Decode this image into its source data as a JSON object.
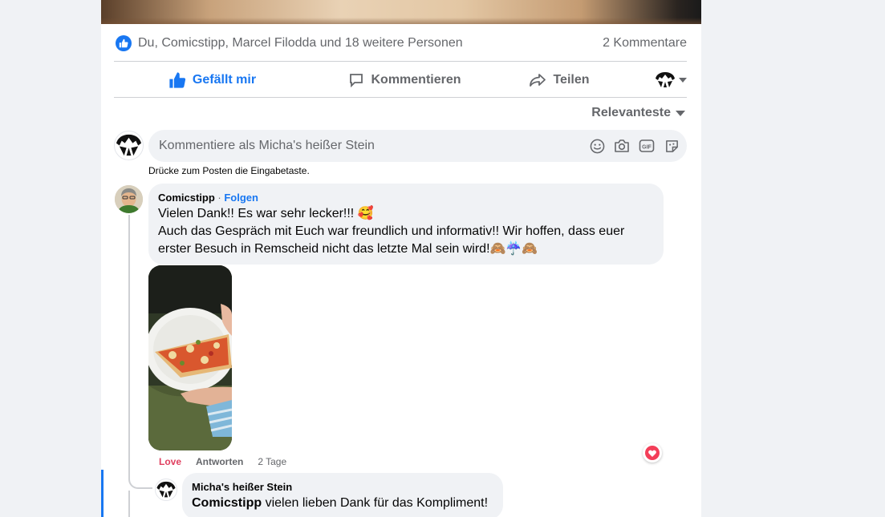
{
  "post": {
    "reactors_text": "Du, Comicstipp, Marcel Filodda und 18 weitere Personen",
    "comment_count": "2 Kommentare"
  },
  "actions": {
    "like": "Gefällt mir",
    "comment": "Kommentieren",
    "share": "Teilen"
  },
  "sort": {
    "label": "Relevanteste"
  },
  "composer": {
    "placeholder": "Kommentiere als Micha's heißer Stein",
    "hint": "Drücke zum Posten die Eingabetaste.",
    "icons": [
      "emoji-icon",
      "camera-icon",
      "gif-icon",
      "sticker-icon"
    ]
  },
  "comments": [
    {
      "author": "Comicstipp",
      "separator": " · ",
      "follow": "Folgen",
      "line1": "Vielen Dank!! Es war sehr lecker!!! 🥰",
      "line2": "Auch das Gespräch mit Euch war freundlich und informativ!! Wir hoffen, dass euer",
      "line3": "erster Besuch in Remscheid nicht das letzte Mal sein wird!🙈☔🙈",
      "love": "Love",
      "reply": "Antworten",
      "time": "2 Tage"
    },
    {
      "author": "Micha's heißer Stein",
      "mention": "Comicstipp",
      "text": " vielen lieben Dank für das Kompliment!"
    }
  ],
  "colors": {
    "accent": "#1877f2",
    "love": "#e03f5f",
    "muted": "#65676b",
    "bubble": "#f0f2f5"
  }
}
